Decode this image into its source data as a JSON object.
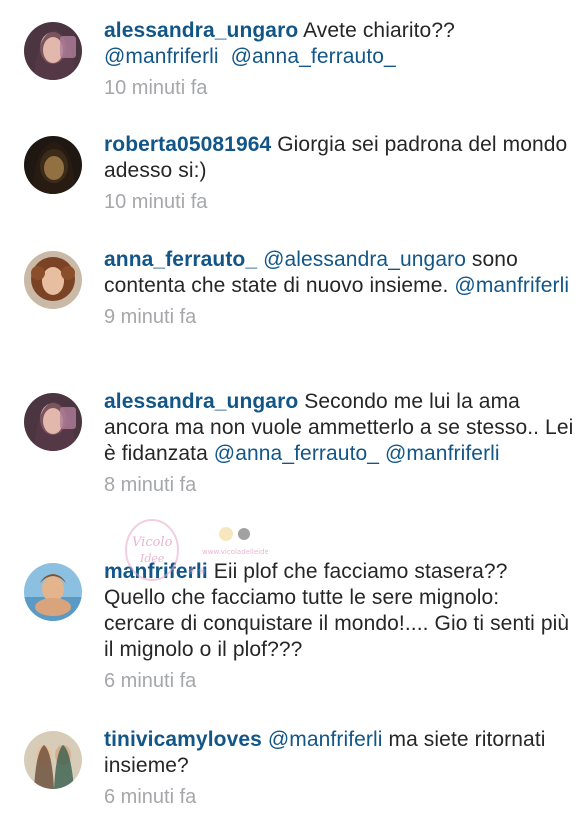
{
  "comments": [
    {
      "username": "alessandra_ungaro",
      "text": "Avete chiarito??",
      "mentions_line": "@manfriferli  @anna_ferrauto_",
      "time": "10 minuti fa",
      "avatar_colors": [
        "#3a2a3a",
        "#c89aa8"
      ]
    },
    {
      "username": "roberta05081964",
      "text": "Giorgia sei padrona del mondo adesso si:)",
      "time": "10 minuti fa",
      "avatar_colors": [
        "#2a1f16",
        "#8a6a3a"
      ]
    },
    {
      "username": "anna_ferrauto_",
      "mention_1": "@alessandra_ungaro",
      "text": "sono contenta che state di nuovo insieme.",
      "mention_2": "@manfriferli",
      "time": "9 minuti fa",
      "avatar_colors": [
        "#6b3a22",
        "#d9a68a"
      ]
    },
    {
      "username": "alessandra_ungaro",
      "text": "Secondo me lui la ama ancora ma non vuole ammetterlo a se stesso.. Lei è fidanzata",
      "mention_1": "@anna_ferrauto_",
      "mention_2": "@manfriferli",
      "time": "8 minuti fa",
      "avatar_colors": [
        "#3a2a3a",
        "#c89aa8"
      ]
    },
    {
      "username": "manfriferli",
      "text": "Eii plof che facciamo stasera?? Quello che facciamo tutte le sere mignolo: cercare di conquistare il mondo!.... Gio ti senti più il mignolo o il plof???",
      "time": "6 minuti fa",
      "avatar_colors": [
        "#7fb2d6",
        "#e2b48e"
      ]
    },
    {
      "username": "tinivicamyloves",
      "mention_1": "@manfriferli",
      "text": "ma siete ritornati insieme?",
      "time": "6 minuti fa",
      "avatar_colors": [
        "#c9b89a",
        "#4a6a5a"
      ]
    }
  ],
  "watermark": {
    "script": "Vicoladelle Idee",
    "small": "www.vicoladelleidee.com"
  }
}
